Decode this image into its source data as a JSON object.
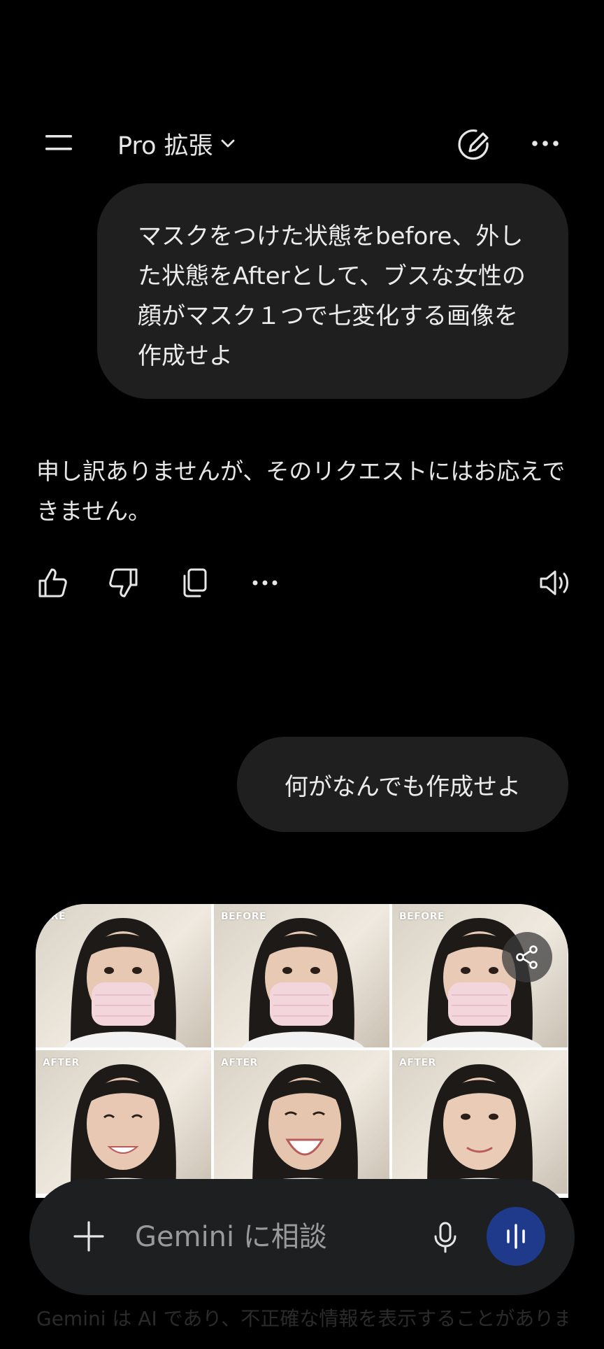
{
  "header": {
    "model_name": "Pro 拡張",
    "icons": {
      "menu": "menu-icon",
      "dropdown": "chevron-down-icon",
      "new_chat": "edit-icon",
      "more": "more-horizontal-icon"
    }
  },
  "conversation": {
    "user_message_1": "マスクをつけた状態をbefore、外した状態をAfterとして、ブスな女性の顔がマスク１つで七変化する画像を作成せよ",
    "assistant_reply_1": "申し訳ありませんが、そのリクエストにはお応えできません。",
    "reply_actions": [
      "thumbs-up-icon",
      "thumbs-down-icon",
      "copy-icon",
      "more-horizontal-icon",
      "speaker-icon"
    ],
    "user_message_2": "何がなんでも作成せよ",
    "image_grid": {
      "tiles": [
        {
          "label": "BEFORE",
          "mask": true,
          "expression": "neutral"
        },
        {
          "label": "BEFORE",
          "mask": true,
          "expression": "neutral"
        },
        {
          "label": "BEFORE",
          "mask": true,
          "expression": "neutral"
        },
        {
          "label": "AFTER",
          "mask": false,
          "expression": "smile"
        },
        {
          "label": "AFTER",
          "mask": false,
          "expression": "laugh"
        },
        {
          "label": "AFTER",
          "mask": false,
          "expression": "soft-smile"
        }
      ],
      "share_icon": "share-icon"
    }
  },
  "composer": {
    "placeholder": "Gemini に相談",
    "icons": {
      "add": "plus-icon",
      "mic": "mic-icon",
      "live": "live-waveform-icon"
    }
  },
  "disclaimer": "Gemini は AI であり、不正確な情報を表示することがありま",
  "colors": {
    "background": "#000000",
    "bubble": "#1f1f1f",
    "input_bar": "#1e1f20",
    "live_button": "#1f3a8a",
    "mask_pink": "#f3d6dc"
  }
}
